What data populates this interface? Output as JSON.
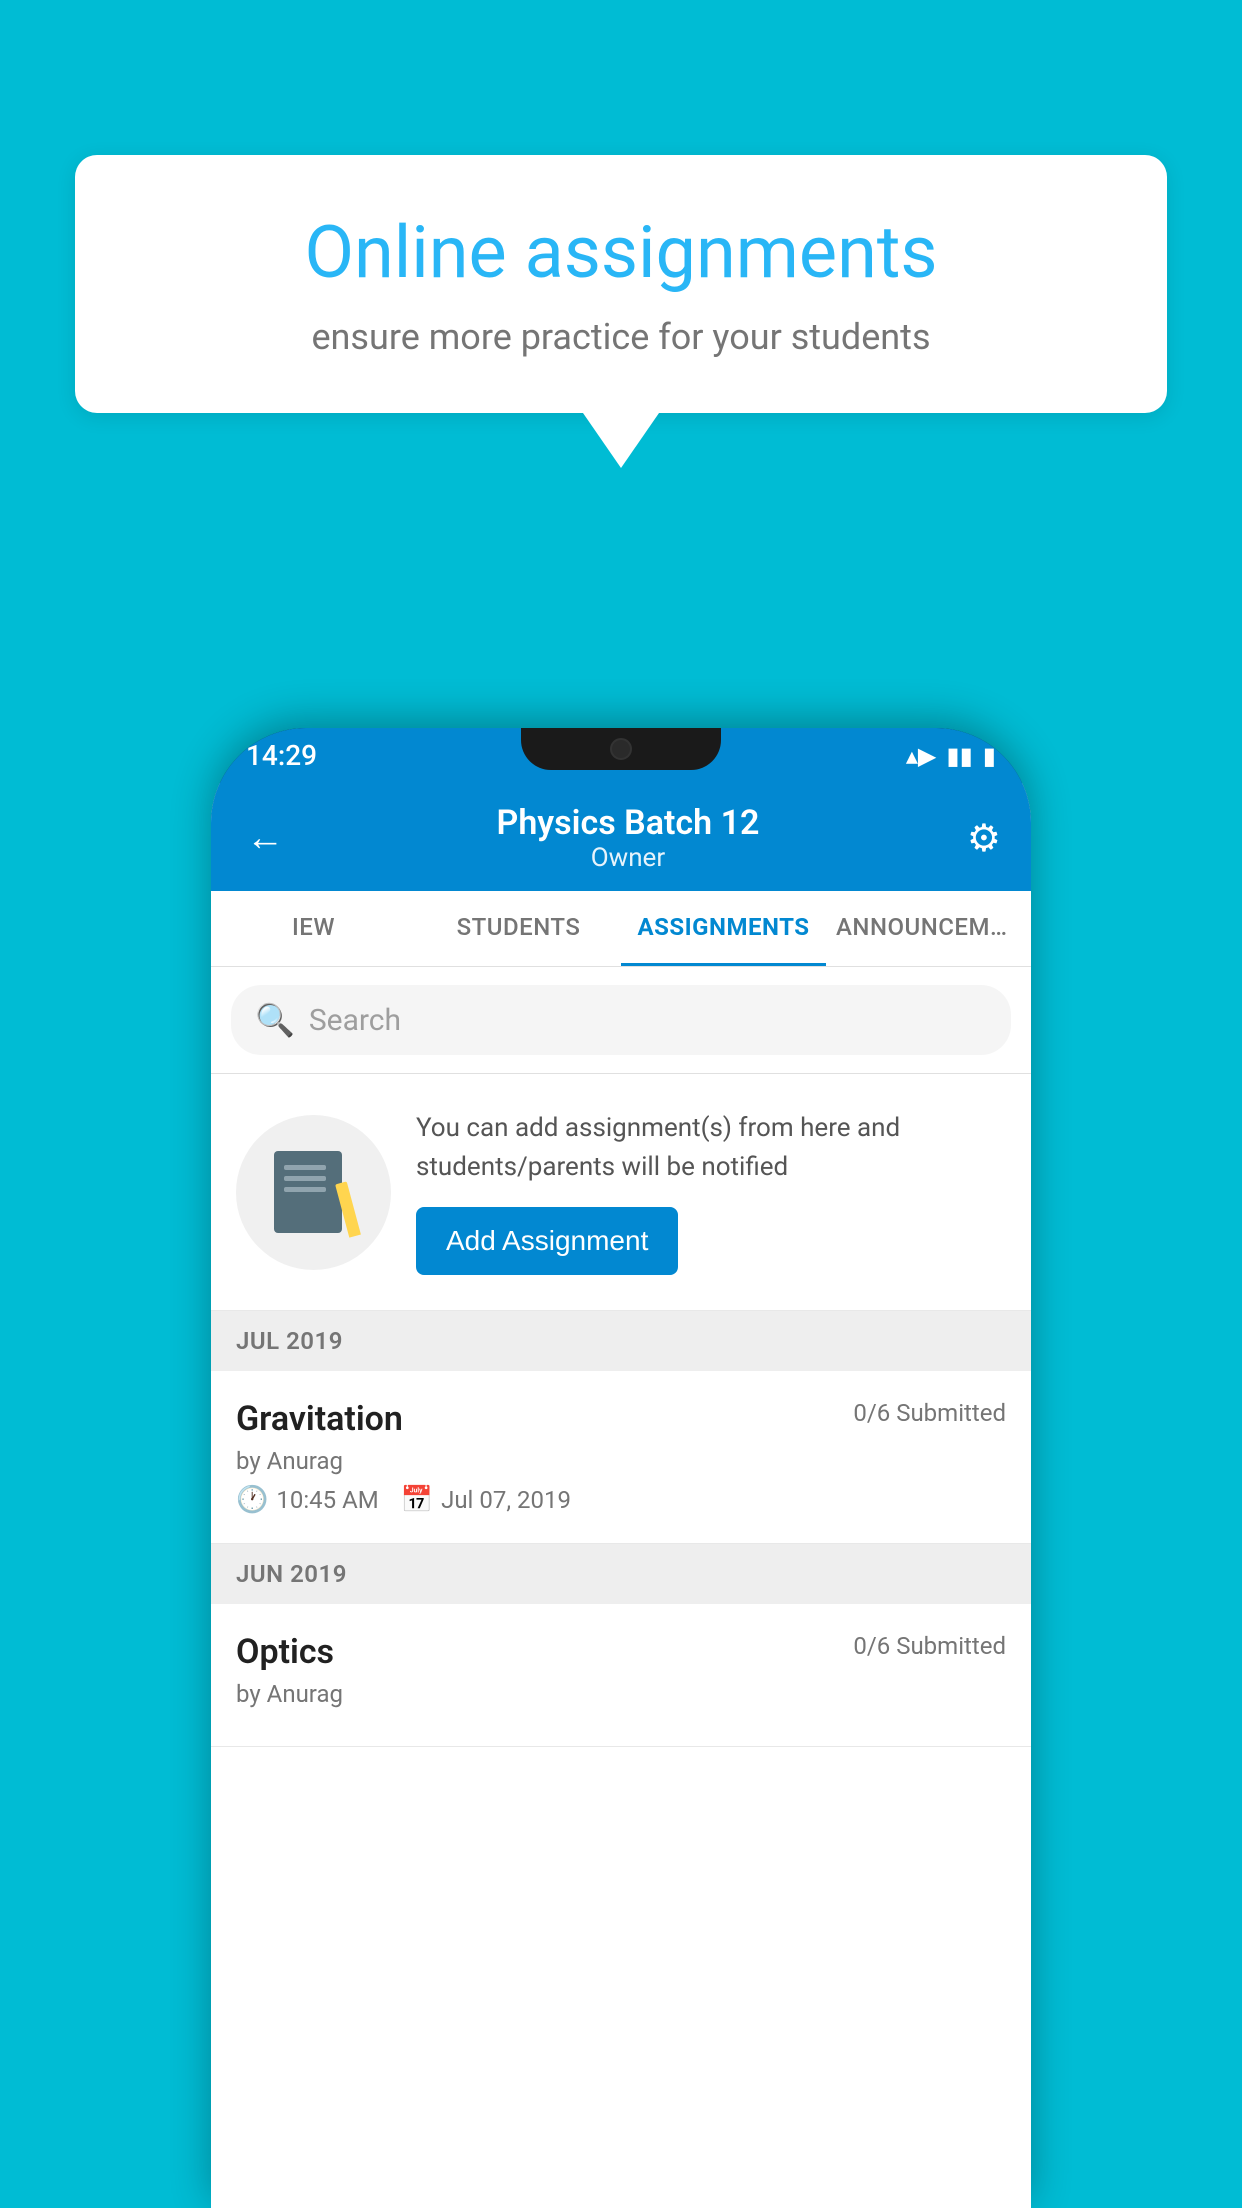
{
  "background_color": "#00bcd4",
  "speech_bubble": {
    "title": "Online assignments",
    "subtitle": "ensure more practice for your students"
  },
  "status_bar": {
    "time": "14:29",
    "wifi_icon": "▼",
    "signal_icon": "◀",
    "battery_icon": "▮"
  },
  "header": {
    "title": "Physics Batch 12",
    "subtitle": "Owner",
    "back_label": "←",
    "settings_label": "⚙"
  },
  "tabs": [
    {
      "label": "IEW",
      "active": false
    },
    {
      "label": "STUDENTS",
      "active": false
    },
    {
      "label": "ASSIGNMENTS",
      "active": true
    },
    {
      "label": "ANNOUNCEMENTS",
      "active": false
    }
  ],
  "search": {
    "placeholder": "Search"
  },
  "promo": {
    "description": "You can add assignment(s) from here and students/parents will be notified",
    "button_label": "Add Assignment"
  },
  "sections": [
    {
      "label": "JUL 2019",
      "assignments": [
        {
          "name": "Gravitation",
          "submitted": "0/6 Submitted",
          "by": "by Anurag",
          "time": "10:45 AM",
          "date": "Jul 07, 2019"
        }
      ]
    },
    {
      "label": "JUN 2019",
      "assignments": [
        {
          "name": "Optics",
          "submitted": "0/6 Submitted",
          "by": "by Anurag",
          "time": "",
          "date": ""
        }
      ]
    }
  ]
}
